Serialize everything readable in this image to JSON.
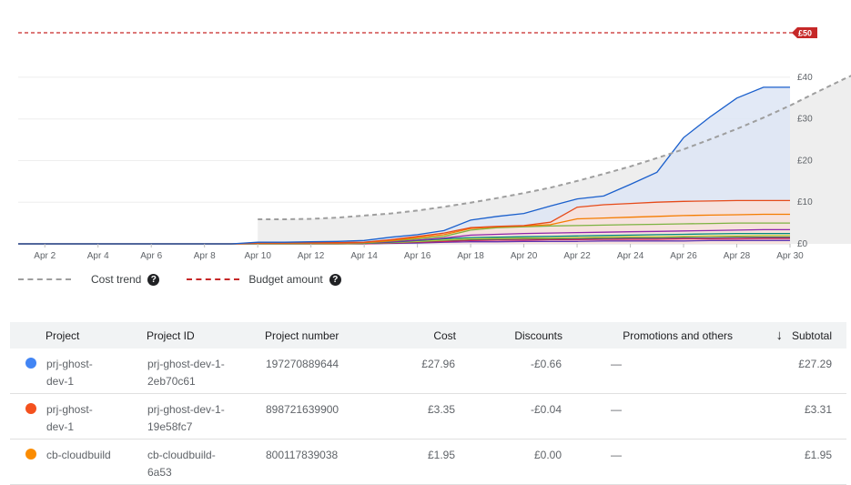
{
  "chart_data": {
    "type": "area",
    "x": [
      "Apr 1",
      "Apr 2",
      "Apr 3",
      "Apr 4",
      "Apr 5",
      "Apr 6",
      "Apr 7",
      "Apr 8",
      "Apr 9",
      "Apr 10",
      "Apr 11",
      "Apr 12",
      "Apr 13",
      "Apr 14",
      "Apr 15",
      "Apr 16",
      "Apr 17",
      "Apr 18",
      "Apr 19",
      "Apr 20",
      "Apr 21",
      "Apr 22",
      "Apr 23",
      "Apr 24",
      "Apr 25",
      "Apr 26",
      "Apr 27",
      "Apr 28",
      "Apr 29",
      "Apr 30"
    ],
    "x_tick_labels": [
      "Apr 2",
      "Apr 4",
      "Apr 6",
      "Apr 8",
      "Apr 10",
      "Apr 12",
      "Apr 14",
      "Apr 16",
      "Apr 18",
      "Apr 20",
      "Apr 22",
      "Apr 24",
      "Apr 26",
      "Apr 28",
      "Apr 30"
    ],
    "y_tick_labels": [
      "£0",
      "£10",
      "£20",
      "£30",
      "£40"
    ],
    "ylim": [
      0,
      52
    ],
    "grid": true,
    "budget": {
      "value": 50,
      "label": "£50",
      "color": "#c62828"
    },
    "series": [
      {
        "color": "#1a5fcc",
        "fill": "#dde5f4",
        "values": [
          0,
          0,
          0,
          0,
          0,
          0,
          0,
          0,
          0,
          0.4,
          0.4,
          0.5,
          0.6,
          0.8,
          1.6,
          2.2,
          3.2,
          5.7,
          6.6,
          7.3,
          9.1,
          10.8,
          11.5,
          14.3,
          17.2,
          25.5,
          30.5,
          35,
          37.6,
          37.6
        ]
      },
      {
        "color": "#e64a19",
        "fill": "#f9e0d8",
        "values": [
          0,
          0,
          0,
          0,
          0,
          0,
          0,
          0,
          0,
          0.2,
          0.2,
          0.3,
          0.3,
          0.4,
          1.0,
          1.8,
          2.6,
          3.9,
          4.2,
          4.4,
          5.2,
          8.8,
          9.4,
          9.7,
          10.0,
          10.2,
          10.3,
          10.4,
          10.4,
          10.4
        ]
      },
      {
        "color": "#f57c00",
        "values": [
          0,
          0,
          0,
          0,
          0,
          0,
          0,
          0,
          0,
          0.2,
          0.2,
          0.2,
          0.2,
          0.3,
          0.8,
          1.5,
          2.2,
          3.7,
          4.1,
          4.3,
          4.6,
          6.0,
          6.2,
          6.4,
          6.6,
          6.8,
          6.9,
          7.0,
          7.1,
          7.1
        ]
      },
      {
        "color": "#7cb342",
        "values": [
          0,
          0,
          0,
          0,
          0,
          0,
          0,
          0,
          0,
          0.1,
          0.1,
          0.2,
          0.2,
          0.2,
          0.7,
          1.2,
          1.8,
          3.3,
          3.9,
          4.1,
          4.3,
          4.4,
          4.5,
          4.6,
          4.7,
          4.8,
          4.9,
          5.0,
          5.0,
          5.0
        ]
      },
      {
        "color": "#8e24aa",
        "values": [
          0,
          0,
          0,
          0,
          0,
          0,
          0,
          0,
          0,
          0.1,
          0.1,
          0.1,
          0.1,
          0.2,
          0.5,
          0.9,
          1.4,
          2.1,
          2.3,
          2.5,
          2.6,
          2.7,
          2.8,
          2.9,
          3.0,
          3.1,
          3.2,
          3.3,
          3.4,
          3.4
        ]
      },
      {
        "color": "#00897b",
        "values": [
          0,
          0,
          0,
          0,
          0,
          0,
          0,
          0,
          0,
          0.1,
          0.1,
          0.1,
          0.1,
          0.1,
          0.4,
          0.8,
          1.2,
          1.5,
          1.6,
          1.7,
          1.8,
          1.9,
          2.0,
          2.1,
          2.2,
          2.3,
          2.4,
          2.5,
          2.5,
          2.5
        ]
      },
      {
        "color": "#c0ca33",
        "values": [
          0,
          0,
          0,
          0,
          0,
          0,
          0,
          0,
          0,
          0,
          0,
          0,
          0,
          0.1,
          0.3,
          0.6,
          0.9,
          1.2,
          1.3,
          1.4,
          1.4,
          1.5,
          1.6,
          1.7,
          1.7,
          1.8,
          1.9,
          1.9,
          2.0,
          2.0
        ]
      },
      {
        "color": "#455a64",
        "values": [
          0,
          0,
          0,
          0,
          0,
          0,
          0,
          0,
          0,
          0,
          0,
          0,
          0,
          0.1,
          0.3,
          0.5,
          0.8,
          1.0,
          1.1,
          1.2,
          1.2,
          1.3,
          1.3,
          1.4,
          1.4,
          1.5,
          1.5,
          1.6,
          1.6,
          1.6
        ]
      },
      {
        "color": "#d81b60",
        "values": [
          0,
          0,
          0,
          0,
          0,
          0,
          0,
          0,
          0,
          0,
          0,
          0,
          0,
          0,
          0.2,
          0.4,
          0.6,
          0.8,
          0.9,
          0.9,
          1.0,
          1.0,
          1.1,
          1.1,
          1.1,
          1.2,
          1.2,
          1.2,
          1.3,
          1.3
        ]
      },
      {
        "color": "#5e35b1",
        "values": [
          0,
          0,
          0,
          0,
          0,
          0,
          0,
          0,
          0,
          0,
          0,
          0,
          0,
          0,
          0.1,
          0.2,
          0.4,
          0.5,
          0.5,
          0.6,
          0.6,
          0.6,
          0.7,
          0.7,
          0.7,
          0.7,
          0.8,
          0.8,
          0.8,
          0.8
        ]
      }
    ],
    "trend": {
      "color": "#9e9e9e",
      "start_index": 9,
      "values": [
        5.9,
        5.9,
        6.0,
        6.3,
        6.8,
        7.3,
        8.0,
        8.9,
        9.9,
        11.0,
        12.2,
        13.5,
        15.1,
        16.8,
        18.6,
        20.6,
        22.7,
        25.1,
        27.6,
        30.3,
        33.2,
        36.4,
        39.5,
        42.4
      ]
    }
  },
  "legend": {
    "cost_trend_label": "Cost trend",
    "budget_label": "Budget amount",
    "help_glyph": "?"
  },
  "table": {
    "headers": {
      "project": "Project",
      "project_id": "Project ID",
      "project_number": "Project number",
      "cost": "Cost",
      "discounts": "Discounts",
      "promotions": "Promotions and others",
      "subtotal": "Subtotal",
      "sort_glyph": "↓"
    },
    "rows": [
      {
        "color": "#4285f4",
        "project": "prj-ghost-\ndev-1",
        "project_id": "prj-ghost-dev-1-\n2eb70c61",
        "project_number": "197270889644",
        "cost": "£27.96",
        "discounts": "-£0.66",
        "promotions": "—",
        "subtotal": "£27.29"
      },
      {
        "color": "#f4511e",
        "project": "prj-ghost-\ndev-1",
        "project_id": "prj-ghost-dev-1-\n19e58fc7",
        "project_number": "898721639900",
        "cost": "£3.35",
        "discounts": "-£0.04",
        "promotions": "—",
        "subtotal": "£3.31"
      },
      {
        "color": "#fb8c00",
        "project": "cb-cloudbuild",
        "project_id": "cb-cloudbuild-\n6a53",
        "project_number": "800117839038",
        "cost": "£1.95",
        "discounts": "£0.00",
        "promotions": "—",
        "subtotal": "£1.95"
      }
    ]
  }
}
